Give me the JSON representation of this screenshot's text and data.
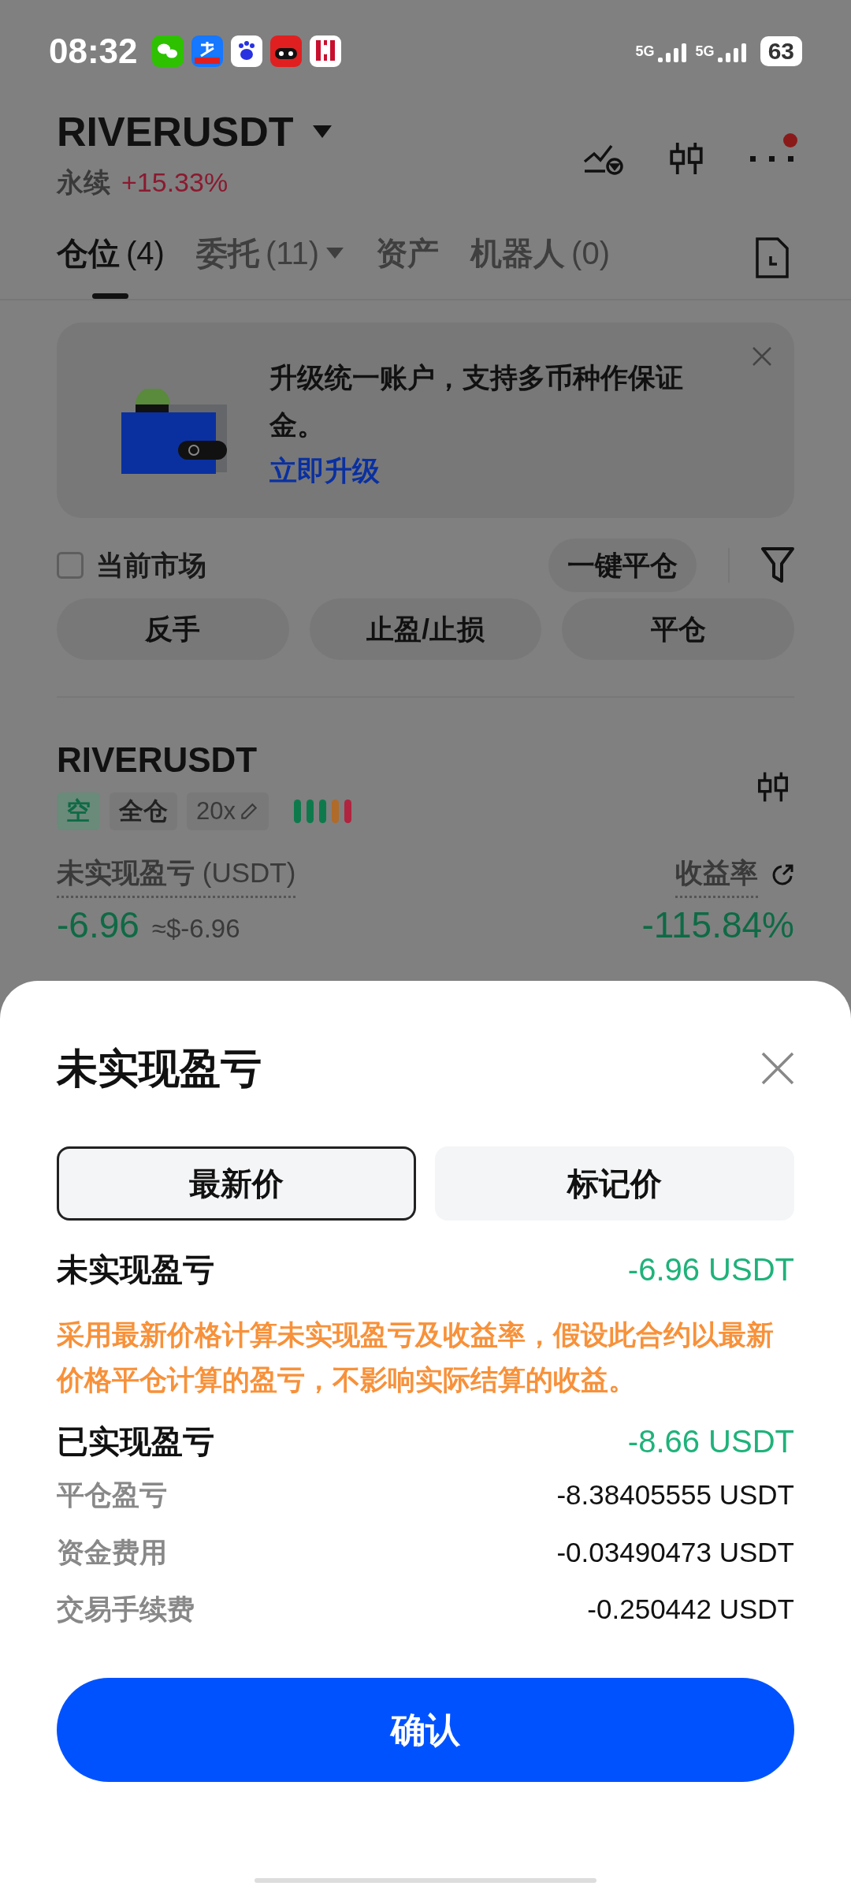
{
  "status_bar": {
    "time": "08:32",
    "apps": [
      {
        "kind": "chat"
      },
      {
        "kind": "pay"
      },
      {
        "kind": "paw"
      },
      {
        "kind": "cat"
      },
      {
        "kind": "coffee"
      }
    ],
    "networks": [
      "5G",
      "5G"
    ],
    "battery": "63"
  },
  "header": {
    "symbol": "RIVERUSDT",
    "type": "永续",
    "change": "+15.33%",
    "more_badge": true
  },
  "tabs": [
    {
      "label": "仓位",
      "count": "(4)",
      "selected": true,
      "dropdown": false
    },
    {
      "label": "委托",
      "count": "(11)",
      "selected": false,
      "dropdown": true
    },
    {
      "label": "资产",
      "selected": false,
      "dropdown": false
    },
    {
      "label": "机器人",
      "count": "(0)",
      "selected": false,
      "dropdown": false
    }
  ],
  "banner": {
    "text": "升级统一账户，支持多币种作保证金。",
    "link": "立即升级"
  },
  "filter": {
    "label": "当前市场",
    "checked": false,
    "close_all": "一键平仓"
  },
  "actions": [
    "反手",
    "止盈/止损",
    "平仓"
  ],
  "position": {
    "symbol": "RIVERUSDT",
    "tags": [
      {
        "text": "空",
        "kind": "side"
      },
      {
        "text": "全仓",
        "kind": "mode"
      },
      {
        "text": "20x",
        "kind": "leverage"
      }
    ],
    "risk_bars": [
      {
        "color": "#0e7a4c"
      },
      {
        "color": "#0e7a4c"
      },
      {
        "color": "#0e7a4c"
      },
      {
        "color": "#b06a2a"
      },
      {
        "color": "#b0243f"
      }
    ],
    "pnl_label": "未实现盈亏",
    "pnl_unit": "(USDT)",
    "pnl_value": "-6.96",
    "pnl_approx": "≈$-6.96",
    "roe_label": "收益率",
    "roe_value": "-115.84%"
  },
  "sheet": {
    "title": "未实现盈亏",
    "segments": [
      {
        "label": "最新价",
        "selected": true
      },
      {
        "label": "标记价",
        "selected": false
      }
    ],
    "unrealized": {
      "label": "未实现盈亏",
      "value": "-6.96 USDT"
    },
    "note": "采用最新价格计算未实现盈亏及收益率，假设此合约以最新价格平仓计算的盈亏，不影响实际结算的收益。",
    "realized": {
      "label": "已实现盈亏",
      "value": "-8.66 USDT"
    },
    "details": [
      {
        "label": "平仓盈亏",
        "value": "-8.38405555 USDT"
      },
      {
        "label": "资金费用",
        "value": "-0.03490473 USDT"
      },
      {
        "label": "交易手续费",
        "value": "-0.250442 USDT"
      }
    ],
    "confirm": "确认"
  }
}
